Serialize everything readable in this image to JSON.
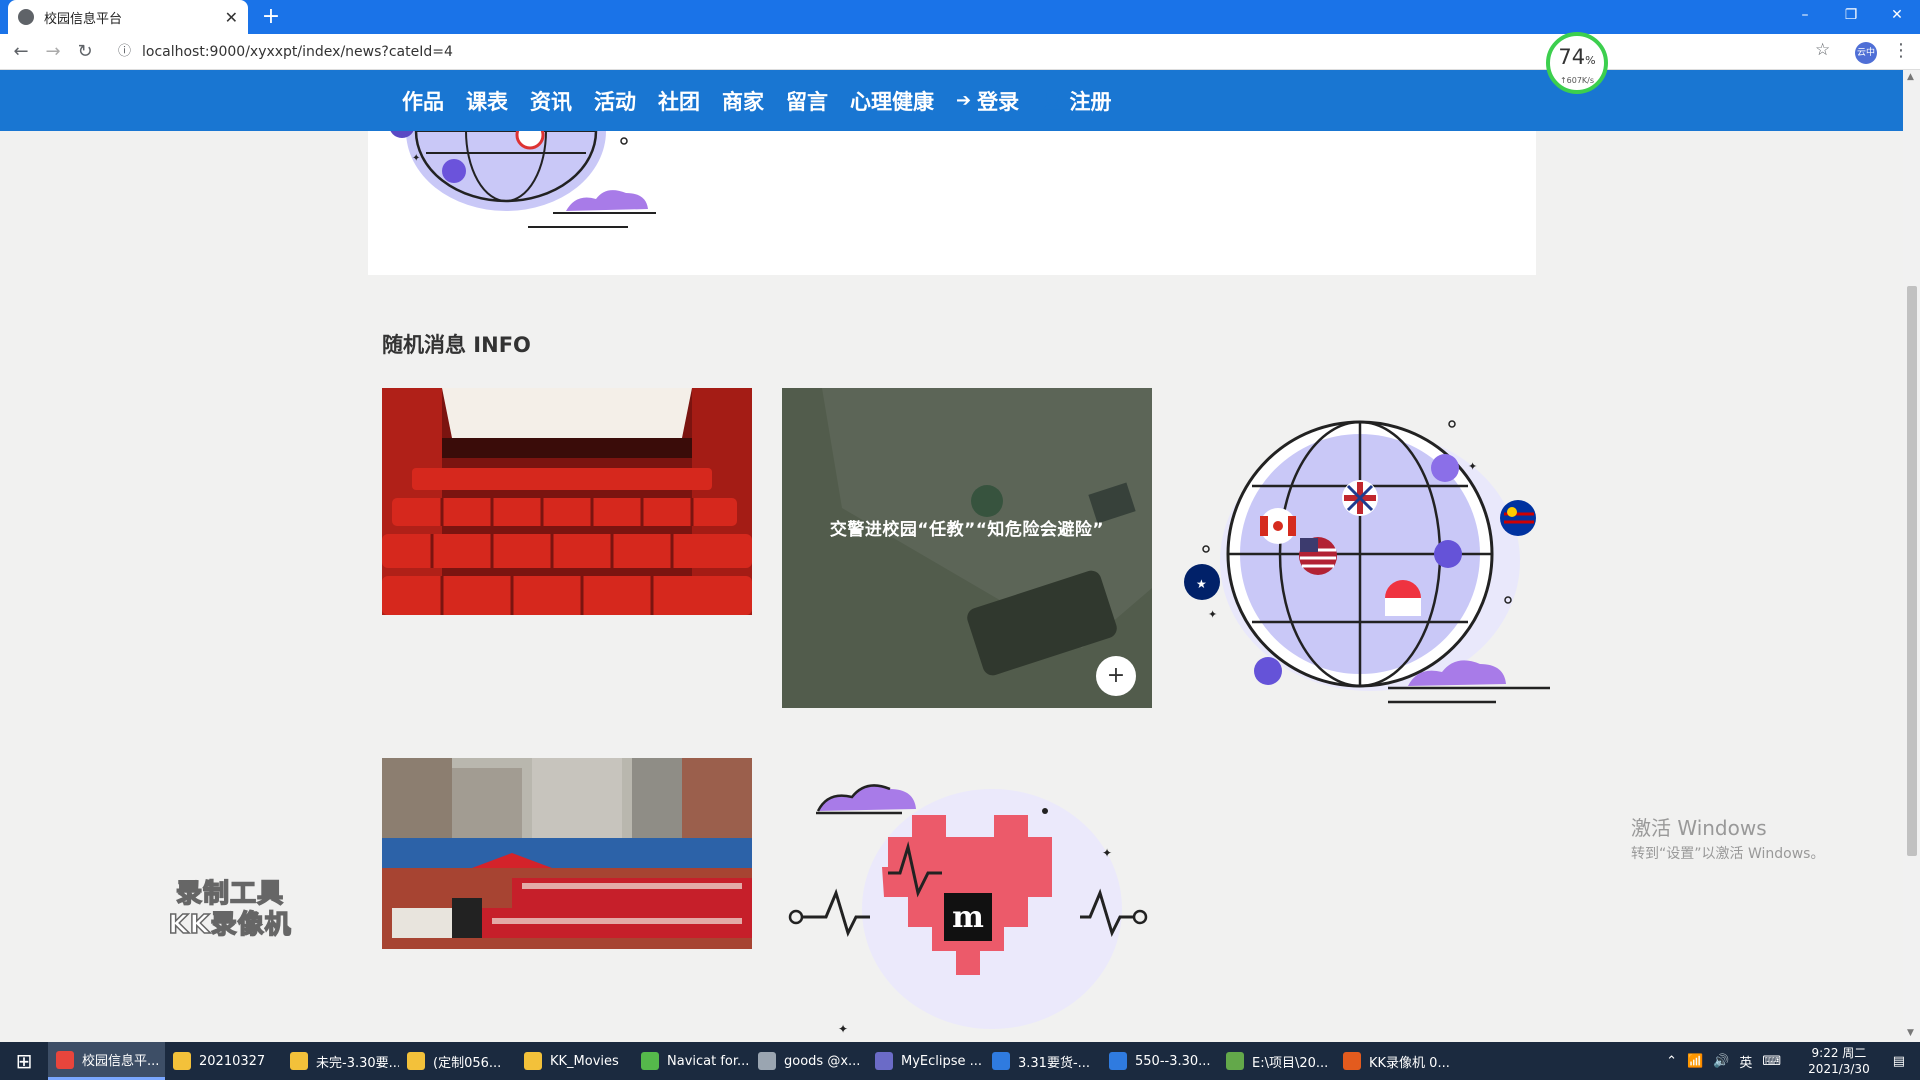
{
  "browser": {
    "tab_title": "校园信息平台",
    "new_tab": "+",
    "url": "localhost:9000/xyxxpt/index/news?cateId=4",
    "window_controls": [
      "–",
      "❐",
      "✕"
    ],
    "profile_label": "云中"
  },
  "speed_widget": {
    "percent": "74",
    "unit": "%",
    "rate": "↑607K/s"
  },
  "nav": {
    "items": [
      {
        "label": "作品"
      },
      {
        "label": "课表"
      },
      {
        "label": "资讯"
      },
      {
        "label": "活动"
      },
      {
        "label": "社团"
      },
      {
        "label": "商家"
      },
      {
        "label": "留言"
      },
      {
        "label": "心理健康"
      }
    ],
    "login": "登录",
    "register": "注册"
  },
  "section": {
    "title": "随机消息 INFO"
  },
  "cards": {
    "feature_caption": "交警进校园“任教”“知危险会避险”",
    "feature_plus": "+"
  },
  "watermark": {
    "line1": "录制工具",
    "line2": "KK录像机"
  },
  "os_notice": {
    "line1": "激活 Windows",
    "line2": "转到“设置”以激活 Windows。"
  },
  "taskbar": {
    "items": [
      {
        "label": "校园信息平...",
        "icon": "chrome-icon",
        "color": "#e8453c",
        "active": true
      },
      {
        "label": "20210327",
        "icon": "folder-icon",
        "color": "#f3c13a"
      },
      {
        "label": "未完-3.30要...",
        "icon": "folder-icon",
        "color": "#f3c13a"
      },
      {
        "label": "(定制056...",
        "icon": "folder-icon",
        "color": "#f3c13a"
      },
      {
        "label": "KK_Movies",
        "icon": "folder-icon",
        "color": "#f3c13a"
      },
      {
        "label": "Navicat for...",
        "icon": "navicat-icon",
        "color": "#55b84b"
      },
      {
        "label": "goods @x...",
        "icon": "database-icon",
        "color": "#9aa5b1"
      },
      {
        "label": "MyEclipse ...",
        "icon": "eclipse-icon",
        "color": "#6b6bc7"
      },
      {
        "label": "3.31要货-...",
        "icon": "doc-icon",
        "color": "#2f7be0"
      },
      {
        "label": "550--3.30...",
        "icon": "doc-icon",
        "color": "#2f7be0"
      },
      {
        "label": "E:\\项目\\20...",
        "icon": "notepad-icon",
        "color": "#63a84a"
      },
      {
        "label": "KK录像机 0...",
        "icon": "recorder-icon",
        "color": "#e35b1e"
      }
    ],
    "ime": "英",
    "time": "9:22 周二",
    "date": "2021/3/30"
  }
}
